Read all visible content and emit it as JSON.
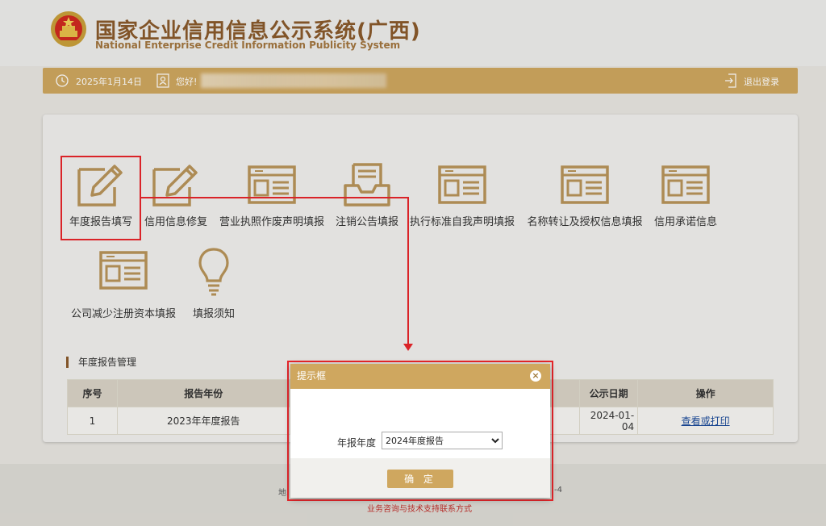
{
  "header": {
    "title_cn": "国家企业信用信息公示系统(广西)",
    "title_en": "National Enterprise Credit Information Publicity System"
  },
  "userbar": {
    "date": "2025年1月14日",
    "greeting": "您好!",
    "logout": "退出登录"
  },
  "menu": [
    {
      "label": "年度报告填写",
      "icon": "pencil-square-icon"
    },
    {
      "label": "信用信息修复",
      "icon": "pencil-square-icon"
    },
    {
      "label": "营业执照作废声明填报",
      "icon": "document-card-icon"
    },
    {
      "label": "注销公告填报",
      "icon": "inbox-tray-icon"
    },
    {
      "label": "执行标准自我声明填报",
      "icon": "document-card-icon"
    },
    {
      "label": "名称转让及授权信息填报",
      "icon": "document-card-icon"
    },
    {
      "label": "信用承诺信息",
      "icon": "document-card-icon"
    },
    {
      "label": "公司减少注册资本填报",
      "icon": "document-card-icon"
    },
    {
      "label": "填报须知",
      "icon": "lightbulb-icon"
    }
  ],
  "section_title": "年度报告管理",
  "table": {
    "headers": [
      "序号",
      "报告年份",
      "",
      "公示日期",
      "操作"
    ],
    "rows": [
      {
        "index": "1",
        "year": "2023年年度报告",
        "date": "2024-01-04",
        "action": "查看或打印"
      }
    ]
  },
  "footer": {
    "line1_left": "地",
    "line1_right": "-4",
    "line2": "业务咨询与技术支持联系方式"
  },
  "modal": {
    "title": "提示框",
    "close": "×",
    "field_label": "年报年度",
    "selected": "2024年度报告",
    "ok": "确 定"
  },
  "colors": {
    "accent": "#cfa75f",
    "brand": "#8a5a2b",
    "highlight": "#e8262b"
  }
}
